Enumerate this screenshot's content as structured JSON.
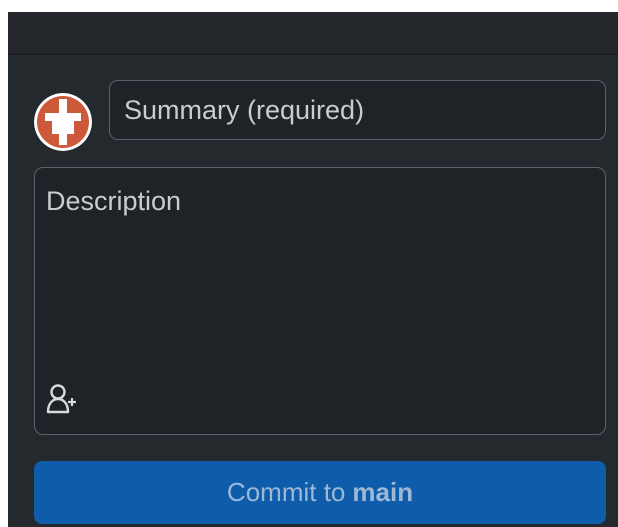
{
  "summary": {
    "placeholder": "Summary (required)"
  },
  "description": {
    "placeholder": "Description"
  },
  "icons": {
    "avatar": "user-avatar",
    "add_coauthor": "person-add-icon"
  },
  "commit_button": {
    "prefix": "Commit to",
    "branch": "main"
  },
  "colors": {
    "panel_bg": "#24292e",
    "input_bg": "#1f2327",
    "input_border": "#5a636d",
    "button_bg": "#0f5cab",
    "avatar_orange": "#cc5a3a"
  }
}
